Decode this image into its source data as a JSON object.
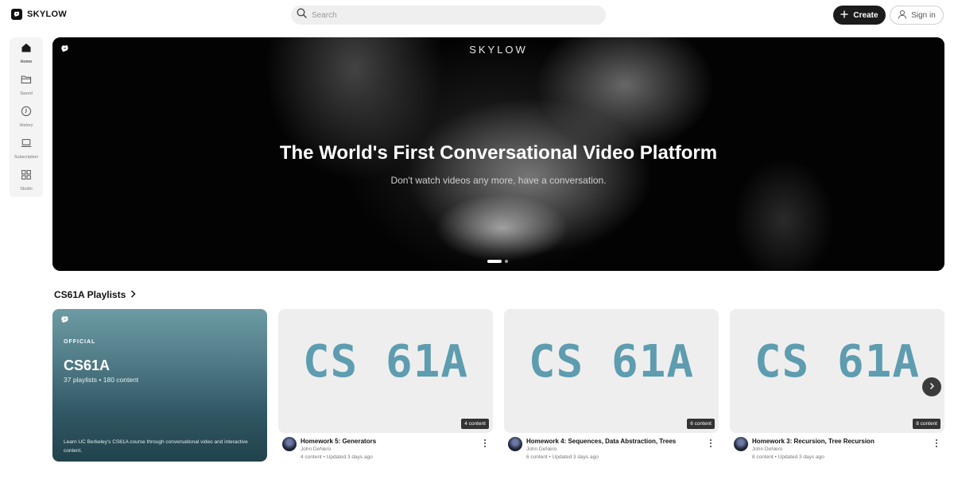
{
  "brand": {
    "name": "SKYLOW"
  },
  "search": {
    "placeholder": "Search"
  },
  "header": {
    "create_label": "Create",
    "signin_label": "Sign in"
  },
  "sidebar": {
    "items": [
      {
        "label": "Home",
        "icon": "home-icon",
        "active": true
      },
      {
        "label": "Saved",
        "icon": "folder-icon",
        "active": false
      },
      {
        "label": "History",
        "icon": "history-icon",
        "active": false
      },
      {
        "label": "Subscription",
        "icon": "laptop-icon",
        "active": false
      },
      {
        "label": "Studio",
        "icon": "grid-icon",
        "active": false
      }
    ]
  },
  "hero": {
    "brand": "SKYLOW",
    "title": "The World's First Conversational Video Platform",
    "subtitle": "Don't watch videos any more, have a conversation.",
    "slides": 2,
    "active_slide": 1
  },
  "section": {
    "title": "CS61A Playlists"
  },
  "featured": {
    "badge": "OFFICIAL",
    "title": "CS61A",
    "stats": "37 playlists • 180 content",
    "description": "Learn UC Berkeley's CS61A course through conversational video and interactive content.",
    "gradient_top": "#6d9ba3",
    "gradient_bottom": "#21424c"
  },
  "playlists": [
    {
      "thumb_text": "CS 61A",
      "badge": "4 content",
      "title": "Homework 5: Generators",
      "author": "John DeNero",
      "meta": "4 content • Updated 3 days ago"
    },
    {
      "thumb_text": "CS 61A",
      "badge": "6 content",
      "title": "Homework 4: Sequences, Data Abstraction, Trees",
      "author": "John DeNero",
      "meta": "6 content • Updated 3 days ago"
    },
    {
      "thumb_text": "CS 61A",
      "badge": "8 content",
      "title": "Homework 3: Recursion, Tree Recursion",
      "author": "John DeNero",
      "meta": "8 content • Updated 3 days ago"
    }
  ],
  "colors": {
    "accent_dark": "#1b1b1b",
    "thumb_text": "#5e9caf"
  }
}
